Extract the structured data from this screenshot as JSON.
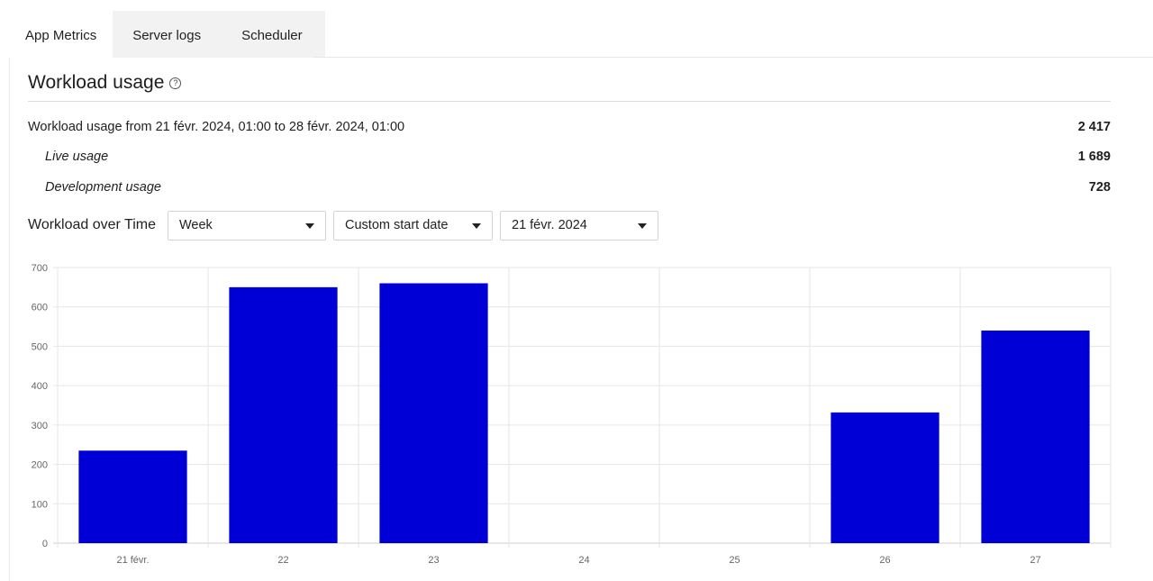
{
  "tabs": [
    {
      "label": "App Metrics",
      "active": true
    },
    {
      "label": "Server logs",
      "active": false
    },
    {
      "label": "Scheduler",
      "active": false
    }
  ],
  "section": {
    "title": "Workload usage",
    "help_icon": "question-circle-icon"
  },
  "usage": {
    "summary_label": "Workload usage from 21 févr. 2024, 01:00 to 28 févr. 2024, 01:00",
    "summary_value": "2 417",
    "live_label": "Live usage",
    "live_value": "1 689",
    "dev_label": "Development usage",
    "dev_value": "728"
  },
  "controls": {
    "label": "Workload over Time",
    "period": "Week",
    "start_mode": "Custom start date",
    "start_date": "21 févr. 2024"
  },
  "colors": {
    "bar": "#0000d6",
    "grid": "#e6e6e6"
  },
  "chart_data": {
    "type": "bar",
    "categories": [
      "21 févr.",
      "22",
      "23",
      "24",
      "25",
      "26",
      "27"
    ],
    "values": [
      235,
      650,
      660,
      0,
      0,
      332,
      540
    ],
    "ylim": [
      0,
      700
    ],
    "yticks": [
      0,
      100,
      200,
      300,
      400,
      500,
      600,
      700
    ],
    "grid": true
  }
}
